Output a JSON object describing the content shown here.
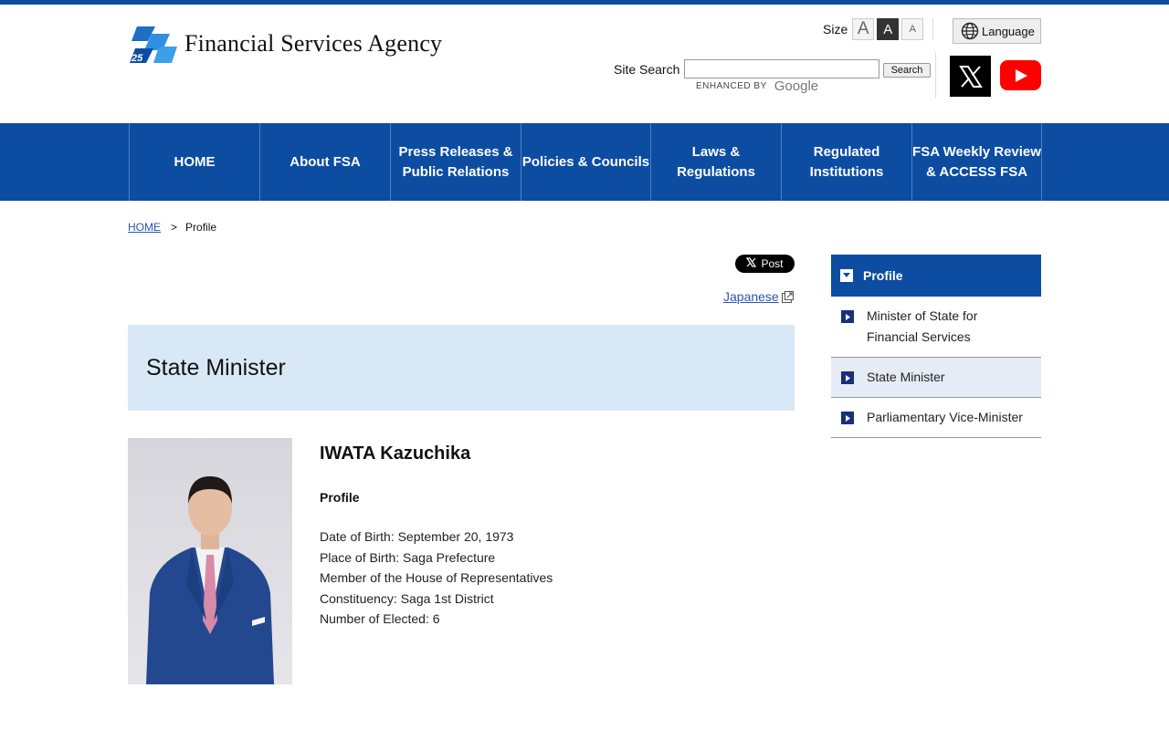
{
  "header": {
    "logo_text": "Financial Services Agency",
    "size_label": "Size",
    "size_buttons": [
      "A",
      "A",
      "A"
    ],
    "language_label": "Language",
    "search_label": "Site Search",
    "search_value": "",
    "search_button": "Search",
    "enhanced_by": "ENHANCED BY",
    "google": "Google"
  },
  "nav": {
    "items": [
      "HOME",
      "About FSA",
      "Press Releases &\nPublic Relations",
      "Policies & Councils",
      "Laws &\nRegulations",
      "Regulated\nInstitutions",
      "FSA Weekly Review\n& ACCESS FSA"
    ]
  },
  "breadcrumb": {
    "home": "HOME",
    "separator": ">",
    "current": "Profile"
  },
  "main": {
    "post_button": "Post",
    "japanese_link": "Japanese",
    "page_title": "State Minister",
    "person_name": "IWATA Kazuchika",
    "profile_heading": "Profile",
    "details": [
      "Date of Birth: September 20, 1973",
      "Place of Birth: Saga Prefecture",
      "Member of the House of Representatives",
      "Constituency: Saga 1st District",
      "Number of Elected: 6"
    ]
  },
  "sidebar": {
    "heading": "Profile",
    "items": [
      "Minister of State for Financial Services",
      "State Minister",
      "Parliamentary Vice-Minister"
    ],
    "active_index": 1
  },
  "colors": {
    "brand_blue": "#0c4da2",
    "title_box": "#d8e8f6",
    "sidebar_active": "#e6ecf5"
  }
}
